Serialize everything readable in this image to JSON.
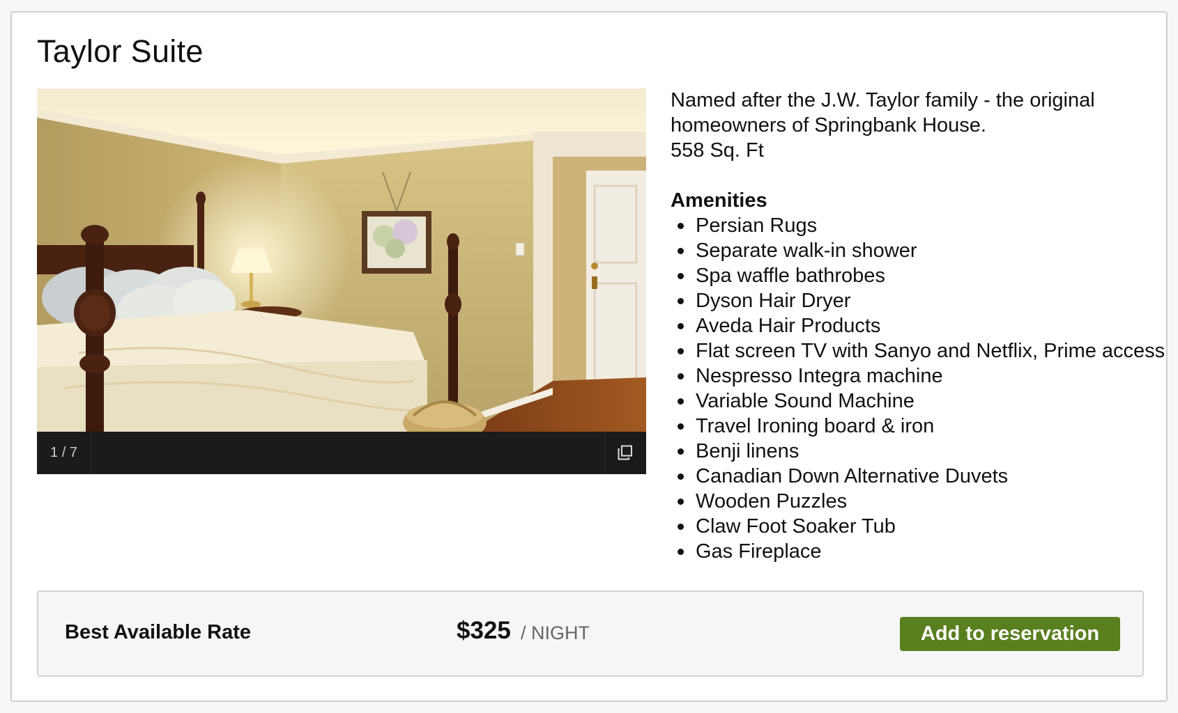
{
  "room": {
    "title": "Taylor Suite",
    "description_line1": "Named after the J.W. Taylor family - the original",
    "description_line2": "homeowners of Springbank House.",
    "size": "558 Sq. Ft"
  },
  "gallery": {
    "counter": "1 / 7",
    "expand_icon": "expand-icon"
  },
  "amenities": {
    "heading": "Amenities",
    "items": [
      "Persian Rugs",
      "Separate walk-in shower",
      "Spa waffle bathrobes",
      "Dyson Hair Dryer",
      "Aveda Hair Products",
      "Flat screen TV with Sanyo and Netflix, Prime access",
      "Nespresso Integra machine",
      "Variable Sound Machine",
      "Travel Ironing board & iron",
      "Benji linens",
      "Canadian Down Alternative Duvets",
      "Wooden Puzzles",
      "Claw Foot Soaker Tub",
      "Gas Fireplace"
    ]
  },
  "rate": {
    "name": "Best Available Rate",
    "price": "$325",
    "unit": "/ NIGHT",
    "button_label": "Add to reservation"
  },
  "colors": {
    "button": "#5a7f1f",
    "rate_background": "#f6f6f6"
  }
}
